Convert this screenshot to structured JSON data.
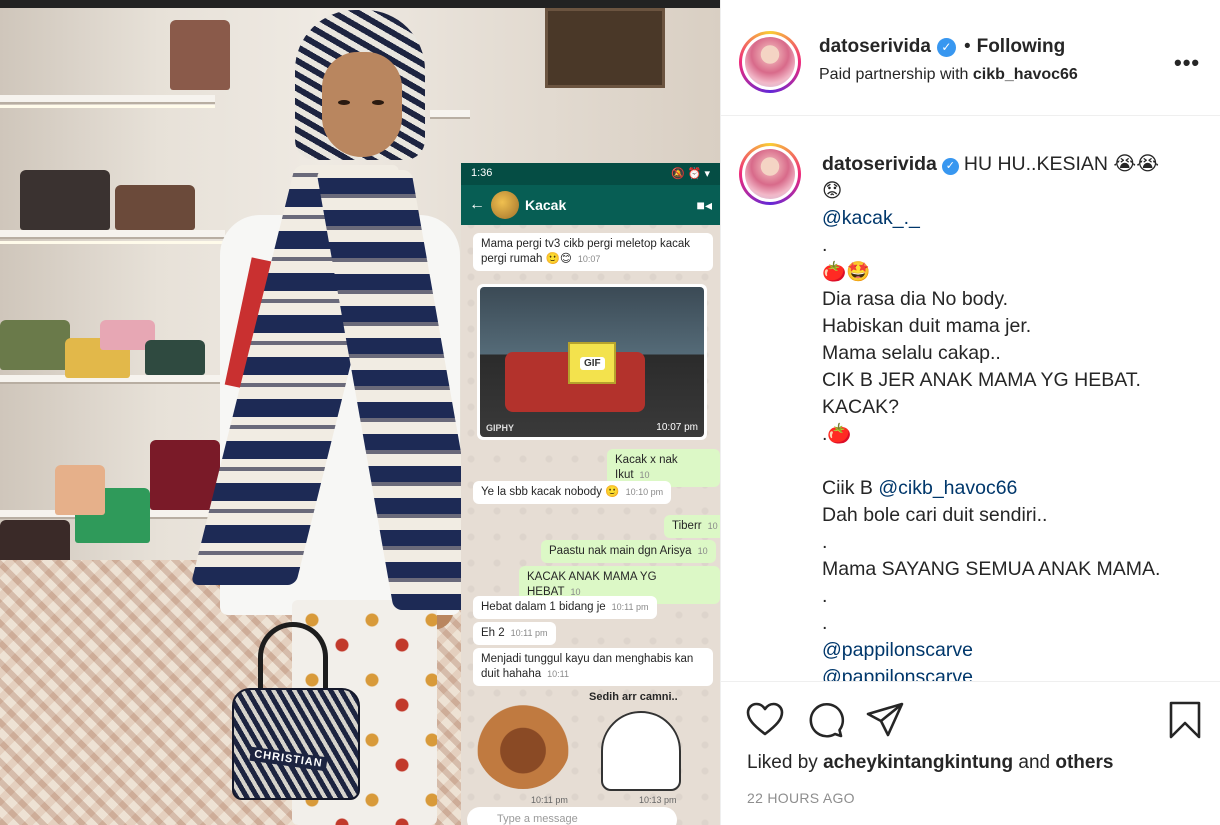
{
  "post": {
    "username": "datoserivida",
    "follow_separator": "•",
    "follow_status": "Following",
    "partnership_prefix": "Paid partnership with",
    "partnership_user": "cikb_havoc66",
    "more_icon": "more-horizontal-icon"
  },
  "caption": {
    "username": "datoserivida",
    "lines": [
      "HU HU..KESIAN 😭😭",
      "😟",
      "@kacak_._",
      ".",
      "🍅🤩",
      "Dia rasa dia No body.",
      "Habiskan duit mama jer.",
      "Mama selalu cakap..",
      "CIK B JER ANAK MAMA YG HEBAT.",
      "KACAK?",
      ".🍅",
      "",
      "Ciik B",
      "@cikb_havoc66",
      "Dah bole cari duit sendiri..",
      ".",
      "Mama SAYANG SEMUA ANAK MAMA.",
      ".",
      ".",
      "@pappilonscarve",
      "@pappilonscarve"
    ]
  },
  "actions": {
    "icons": [
      "heart-icon",
      "comment-icon",
      "share-icon",
      "bookmark-icon"
    ],
    "liked_prefix": "Liked by",
    "liked_user": "acheykintangkintung",
    "liked_and": "and",
    "liked_others": "others",
    "time_ago": "22 HOURS AGO"
  },
  "photo": {
    "handbag_text": "CHRISTIAN",
    "whatsapp": {
      "status_time": "1:36",
      "contact": "Kacak",
      "messages": [
        {
          "text": "Mama pergi tv3 cikb pergi meletop kacak pergi rumah 🙂😊",
          "time": "10:07"
        },
        {
          "text": "GIF",
          "time": "10:07 pm",
          "footer": "GIPHY"
        },
        {
          "text": "Kacak x nak Ikut",
          "time": "10"
        },
        {
          "text": "Ye la sbb kacak nobody 🙂",
          "time": "10:10 pm"
        },
        {
          "text": "Tiberr",
          "time": "10"
        },
        {
          "text": "Paastu nak main dgn Arisya",
          "time": "10"
        },
        {
          "text": "KACAK ANAK MAMA YG HEBAT",
          "time": "10"
        },
        {
          "text": "Hebat dalam 1 bidang je",
          "time": "10:11 pm"
        },
        {
          "text": "Eh 2",
          "time": "10:11 pm"
        },
        {
          "text": "Menjadi tunggul kayu dan menghabis kan duit hahaha",
          "time": "10:11"
        },
        {
          "text": "Sedih arr camni..",
          "time": ""
        }
      ],
      "sticker_time_1": "10:11 pm",
      "sticker_time_2": "10:13 pm",
      "input_placeholder": "Type a message"
    }
  }
}
